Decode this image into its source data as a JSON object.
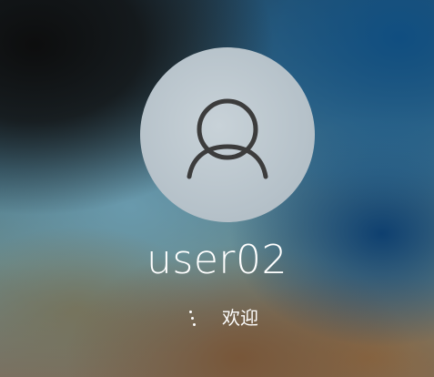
{
  "login": {
    "username": "user02",
    "status_text": "欢迎"
  },
  "icons": {
    "avatar": "user-silhouette-icon",
    "spinner": "loading-spinner-icon"
  },
  "colors": {
    "avatar_bg": "#b8c4cb",
    "avatar_glyph": "#3c3c3c",
    "text": "#ffffff"
  }
}
